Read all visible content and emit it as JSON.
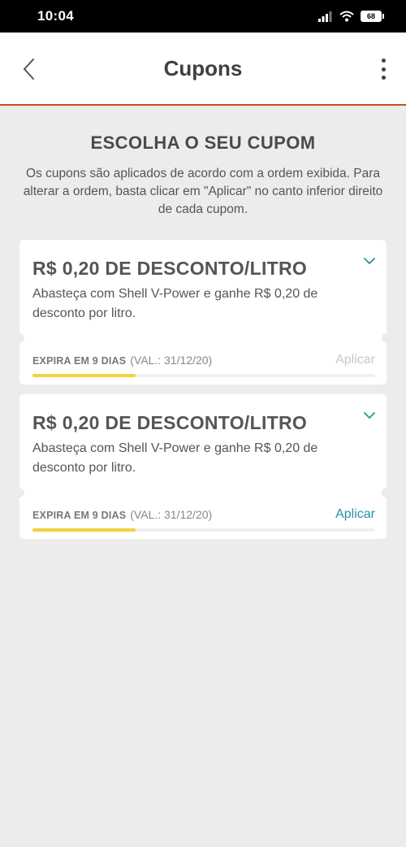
{
  "status_bar": {
    "time": "10:04",
    "signal": "signal-icon",
    "wifi": "wifi-icon",
    "battery": "68"
  },
  "app_bar": {
    "title": "Cupons",
    "back_icon": "chevron-left-icon",
    "menu_icon": "more-vertical-icon"
  },
  "section": {
    "title": "ESCOLHA O SEU CUPOM",
    "description": "Os cupons são aplicados de acordo com a ordem exibida. Para alterar a ordem, basta clicar em \"Aplicar\" no canto inferior direito de cada cupom."
  },
  "coupons": [
    {
      "title": "R$ 0,20 DE DESCONTO/LITRO",
      "description": "Abasteça com Shell V-Power e ganhe R$ 0,20 de desconto por litro.",
      "expire_label": "EXPIRA EM 9 DIAS",
      "validity": "(VAL.: 31/12/20)",
      "apply_label": "Aplicar",
      "apply_enabled": false,
      "progress": 0.3
    },
    {
      "title": "R$ 0,20 DE DESCONTO/LITRO",
      "description": "Abasteça com Shell V-Power e ganhe R$ 0,20 de desconto por litro.",
      "expire_label": "EXPIRA EM 9 DIAS",
      "validity": "(VAL.: 31/12/20)",
      "apply_label": "Aplicar",
      "apply_enabled": true,
      "progress": 0.3
    }
  ],
  "colors": {
    "accent": "#d0491f",
    "link": "#2b91a3",
    "progress": "#f3d23c",
    "background": "#ececec"
  }
}
